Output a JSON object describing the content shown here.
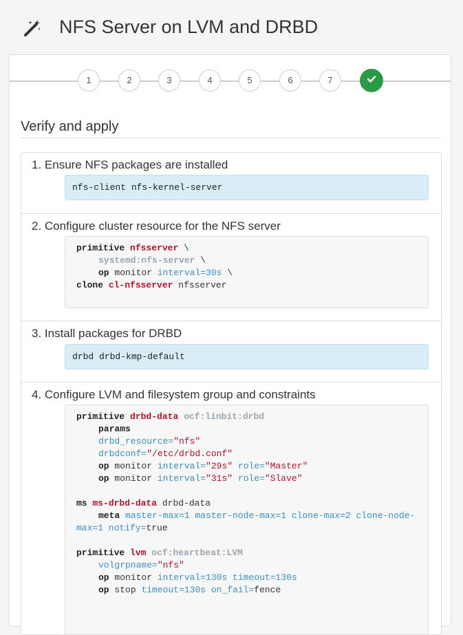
{
  "header": {
    "title": "NFS Server on LVM and DRBD",
    "icon": "magic-wand-icon"
  },
  "wizard": {
    "steps": [
      "1",
      "2",
      "3",
      "4",
      "5",
      "6",
      "7"
    ],
    "completed_icon": "check-icon",
    "accent_color": "#2a9a45"
  },
  "section_title": "Verify and apply",
  "items": [
    {
      "title": "1. Ensure NFS packages are installed",
      "packages": "nfs-client nfs-kernel-server"
    },
    {
      "title": "2. Configure cluster resource for the NFS server",
      "code": {
        "l1": {
          "kw": "primitive",
          "id": "nfsserver",
          "tail": "\\"
        },
        "l2": {
          "cls": "systemd:nfs-server",
          "tail": "\\"
        },
        "l3": {
          "kw": "op",
          "plain": "monitor",
          "attr": "interval=30s",
          "tail": "\\"
        },
        "l4": {
          "kw": "clone",
          "id": "cl-nfsserver",
          "plain": "nfsserver"
        }
      }
    },
    {
      "title": "3. Install packages for DRBD",
      "packages": "drbd drbd-kmp-default"
    },
    {
      "title": "4. Configure LVM and filesystem group and constraints",
      "code": {
        "l1": {
          "kw": "primitive",
          "id": "drbd-data",
          "cls": "ocf:linbit:drbd"
        },
        "l2": {
          "kw": "params"
        },
        "l3": {
          "attr": "drbd_resource=",
          "val": "\"nfs\""
        },
        "l4": {
          "attr": "drbdconf=",
          "val": "\"/etc/drbd.conf\""
        },
        "l5": {
          "kw": "op",
          "plain": "monitor",
          "attr": "interval=",
          "val": "\"29s\"",
          "attr2": "role=",
          "val2": "\"Master\""
        },
        "l6": {
          "kw": "op",
          "plain": "monitor",
          "attr": "interval=",
          "val": "\"31s\"",
          "attr2": "role=",
          "val2": "\"Slave\""
        },
        "l7": {
          "kw": "ms",
          "id": "ms-drbd-data",
          "plain": "drbd-data"
        },
        "l8": {
          "kw": "meta",
          "attr": "master-max=1 master-node-max=1 clone-max=2 clone-node-max=1 notify=",
          "plain": "true"
        },
        "l9": {
          "kw": "primitive",
          "id": "lvm",
          "cls": "ocf:heartbeat:LVM"
        },
        "l10": {
          "attr": "volgrpname=",
          "val": "\"nfs\""
        },
        "l11": {
          "kw": "op",
          "plain": "monitor",
          "attr": "interval=130s timeout=130s"
        },
        "l12": {
          "kw": "op",
          "plain": "stop",
          "attr": "timeout=130s on_fail=",
          "plain2": "fence"
        }
      }
    }
  ]
}
